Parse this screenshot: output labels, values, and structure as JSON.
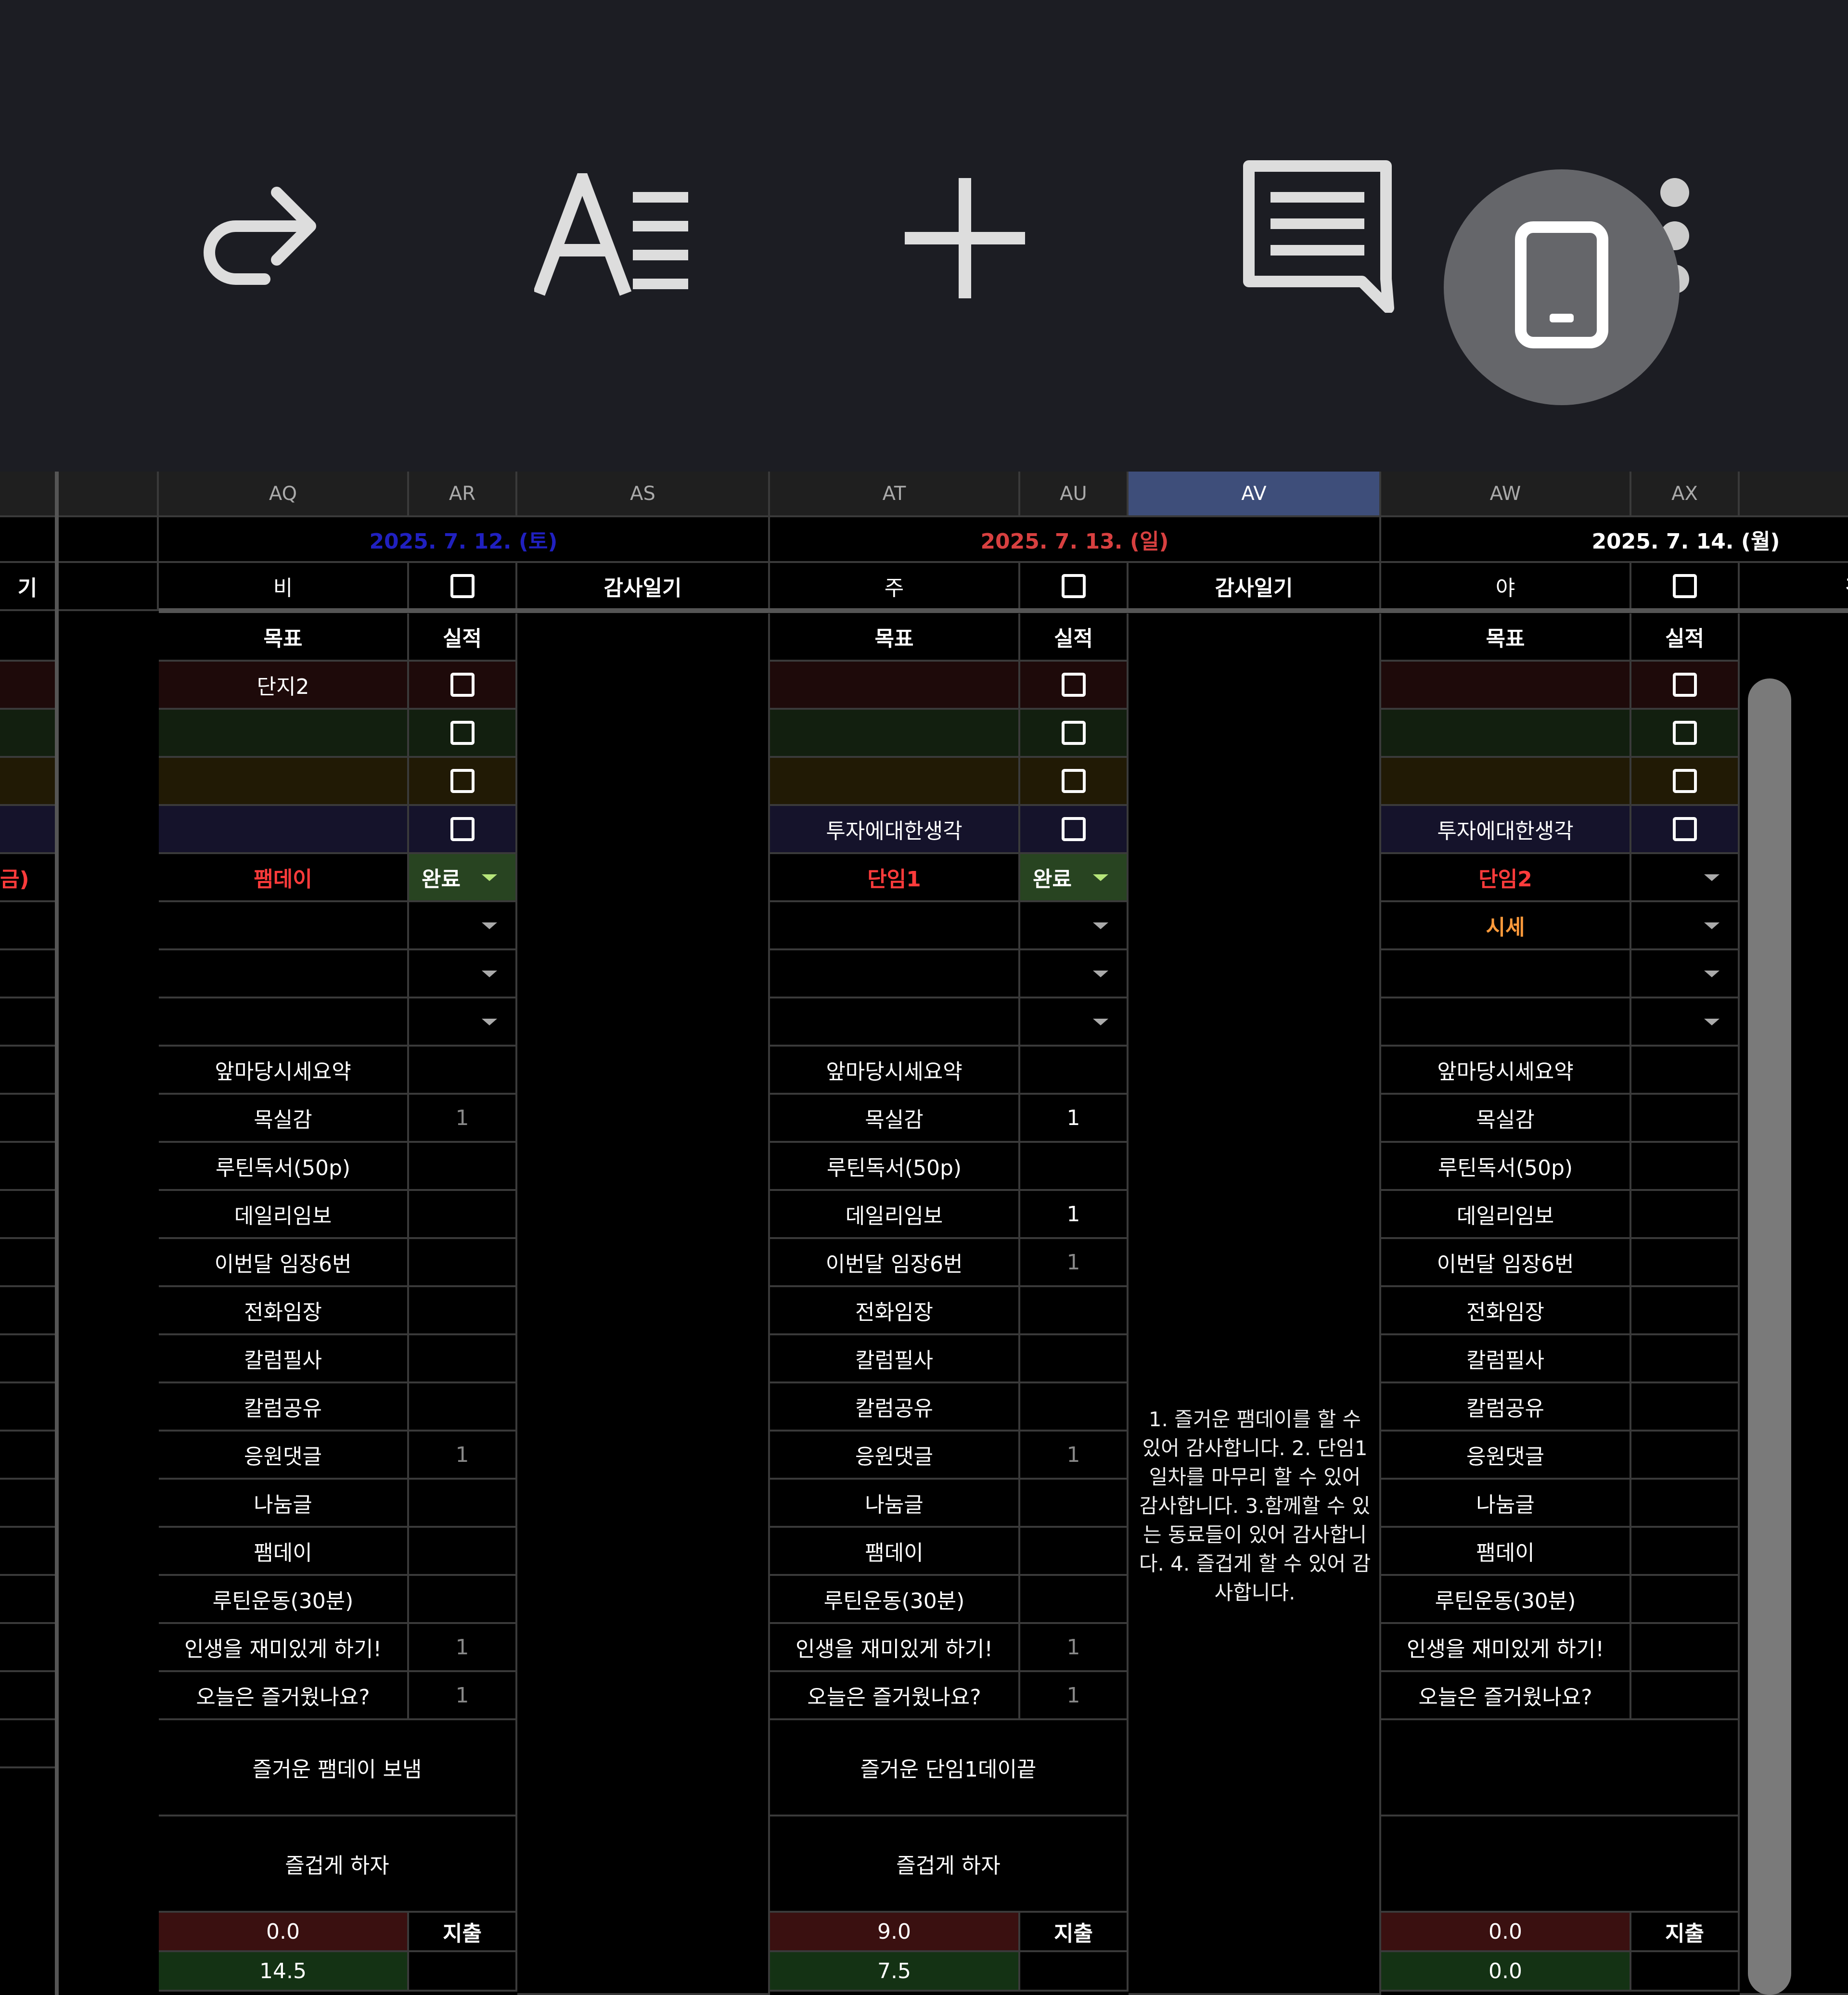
{
  "toolbar": {
    "icons": [
      "redo-icon",
      "text-format-icon",
      "add-icon",
      "comment-icon",
      "device-icon",
      "more-icon"
    ]
  },
  "columns": {
    "AQ": "AQ",
    "AR": "AR",
    "AS": "AS",
    "AT": "AT",
    "AU": "AU",
    "AV": "AV",
    "AW": "AW",
    "AX": "AX"
  },
  "days": [
    {
      "date": "2025. 7. 12. (토)",
      "date_color": "#2020c0",
      "weather": "비",
      "goal_label": "목표",
      "result_label": "실적",
      "journal_label": "감사일기",
      "goals": [
        "단지2",
        "",
        "",
        ""
      ],
      "tasks": [
        {
          "name": "팸데이",
          "status": "완료"
        },
        {
          "name": "",
          "status": ""
        },
        {
          "name": "",
          "status": ""
        },
        {
          "name": "",
          "status": ""
        }
      ],
      "checklist": [
        [
          "앞마당시세요약",
          ""
        ],
        [
          "목실감",
          "1"
        ],
        [
          "루틴독서(50p)",
          ""
        ],
        [
          "데일리임보",
          ""
        ],
        [
          "이번달 임장6번",
          ""
        ],
        [
          "전화임장",
          ""
        ],
        [
          "칼럼필사",
          ""
        ],
        [
          "칼럼공유",
          ""
        ],
        [
          "응원댓글",
          "1"
        ],
        [
          "나눔글",
          ""
        ],
        [
          "팸데이",
          ""
        ],
        [
          "루틴운동(30분)",
          ""
        ],
        [
          "인생을 재미있게 하기!",
          "1"
        ],
        [
          "오늘은 즐거웠나요?",
          "1"
        ]
      ],
      "summary": "즐거운 팸데이 보냄",
      "motto": "즐겁게 하자",
      "amount1": "0.0",
      "amount2": "14.5",
      "expense_label": "지출",
      "journal": ""
    },
    {
      "date": "2025. 7. 13. (일)",
      "date_color": "#d84040",
      "weather": "주",
      "goal_label": "목표",
      "result_label": "실적",
      "journal_label": "감사일기",
      "goals": [
        "",
        "",
        "",
        "투자에대한생각"
      ],
      "tasks": [
        {
          "name": "단임1",
          "status": "완료"
        },
        {
          "name": "",
          "status": ""
        },
        {
          "name": "",
          "status": ""
        },
        {
          "name": "",
          "status": ""
        }
      ],
      "checklist": [
        [
          "앞마당시세요약",
          ""
        ],
        [
          "목실감",
          "1"
        ],
        [
          "루틴독서(50p)",
          ""
        ],
        [
          "데일리임보",
          "1"
        ],
        [
          "이번달 임장6번",
          "1"
        ],
        [
          "전화임장",
          ""
        ],
        [
          "칼럼필사",
          ""
        ],
        [
          "칼럼공유",
          ""
        ],
        [
          "응원댓글",
          "1"
        ],
        [
          "나눔글",
          ""
        ],
        [
          "팸데이",
          ""
        ],
        [
          "루틴운동(30분)",
          ""
        ],
        [
          "인생을 재미있게 하기!",
          "1"
        ],
        [
          "오늘은 즐거웠나요?",
          "1"
        ]
      ],
      "summary": "즐거운 단임1데이끝",
      "motto": "즐겁게 하자",
      "amount1": "9.0",
      "amount2": "7.5",
      "expense_label": "지출",
      "journal": "1. 즐거운 팸데이를 할 수 있어 감사합니다. 2. 단임1일차를 마무리 할 수 있어 감사합니다. 3.함께할 수 있는 동료들이 있어 감사합니다. 4. 즐겁게 할 수 있어 감사합니다."
    },
    {
      "date": "2025. 7. 14. (월)",
      "date_color": "#ffffff",
      "weather": "야",
      "goal_label": "목표",
      "result_label": "실적",
      "journal_label": "감사",
      "goals": [
        "",
        "",
        "",
        "투자에대한생각"
      ],
      "tasks": [
        {
          "name": "단임2",
          "status": ""
        },
        {
          "name": "시세",
          "status": ""
        },
        {
          "name": "",
          "status": ""
        },
        {
          "name": "",
          "status": ""
        }
      ],
      "checklist": [
        [
          "앞마당시세요약",
          ""
        ],
        [
          "목실감",
          ""
        ],
        [
          "루틴독서(50p)",
          ""
        ],
        [
          "데일리임보",
          ""
        ],
        [
          "이번달 임장6번",
          ""
        ],
        [
          "전화임장",
          ""
        ],
        [
          "칼럼필사",
          ""
        ],
        [
          "칼럼공유",
          ""
        ],
        [
          "응원댓글",
          ""
        ],
        [
          "나눔글",
          ""
        ],
        [
          "팸데이",
          ""
        ],
        [
          "루틴운동(30분)",
          ""
        ],
        [
          "인생을 재미있게 하기!",
          ""
        ],
        [
          "오늘은 즐거웠나요?",
          ""
        ]
      ],
      "summary": "",
      "motto": "",
      "amount1": "0.0",
      "amount2": "0.0",
      "expense_label": "지출",
      "journal": ""
    }
  ],
  "left_partial": {
    "header_fragment": "기",
    "task_fragment": "금)"
  },
  "colors": {
    "goal_row1": "#1e0a0a",
    "goal_row2": "#121f0f",
    "goal_row3": "#211a05",
    "goal_row4": "#15132b",
    "amount1_bg": "#3a1010",
    "amount2_bg": "#143214",
    "task_name": "#ff3b3b",
    "task2_name": "#ff9a3b"
  }
}
